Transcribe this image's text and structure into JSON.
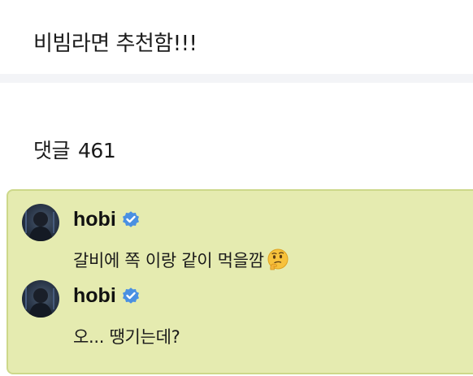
{
  "post": {
    "text": "비빔라면 추천함!!!"
  },
  "comments_section": {
    "label": "댓글",
    "count": "461"
  },
  "comments": [
    {
      "username": "hobi",
      "verified": true,
      "text": "갈비에 쪽 이랑 같이 먹을깜",
      "emoji": "thinking-face"
    },
    {
      "username": "hobi",
      "verified": true,
      "text": "오... 땡기는데?"
    }
  ],
  "colors": {
    "highlight_background": "#e5ebb0",
    "highlight_border": "#cdd88a",
    "verified_badge": "#4a90e2",
    "divider": "#f3f4f7"
  }
}
